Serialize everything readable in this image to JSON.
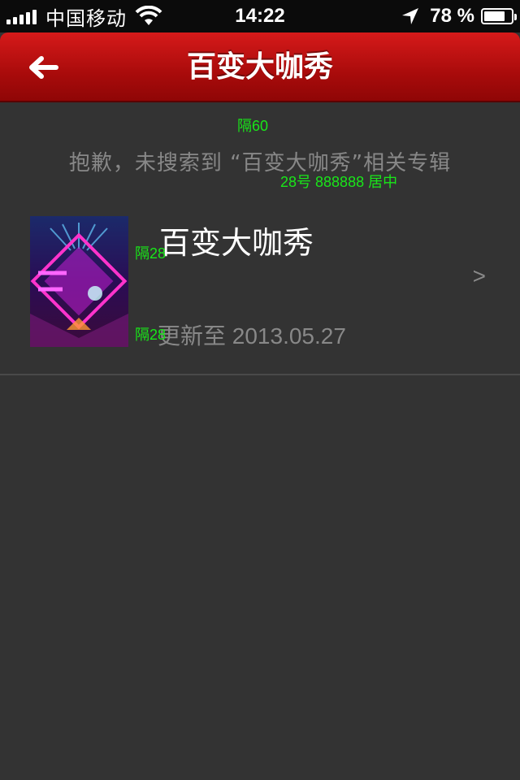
{
  "status_bar": {
    "carrier": "中国移动",
    "time": "14:22",
    "battery_percent": "78 %",
    "battery_level": 0.78
  },
  "nav": {
    "title": "百变大咖秀",
    "back_icon": "back-arrow-icon"
  },
  "annotations": {
    "gap_top": "隔60",
    "font_note": "28号 888888  居中",
    "gap_a": "隔28",
    "gap_b": "隔28"
  },
  "search": {
    "no_result_message": "抱歉，未搜索到 “百变大咖秀”相关专辑"
  },
  "album": {
    "title": "百变大咖秀",
    "updated": "更新至 2013.05.27",
    "chevron": ">"
  },
  "colors": {
    "nav_red": "#c01010",
    "background": "#333333",
    "muted_text": "#888888",
    "annotation_green": "#19e619"
  }
}
